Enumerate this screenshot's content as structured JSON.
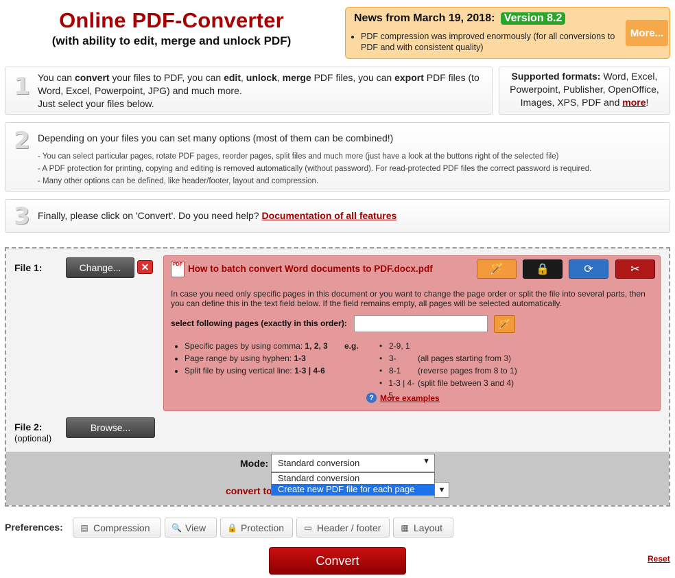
{
  "header": {
    "title": "Online PDF-Converter",
    "subtitle": "(with ability to edit, merge and unlock PDF)"
  },
  "news": {
    "heading": "News from March 19, 2018:",
    "version": "Version 8.2",
    "item": "PDF compression was improved enormously (for all conversions to PDF and with consistent quality)",
    "more_label": "More..."
  },
  "step1": {
    "number": "1",
    "t1": "You can ",
    "b1": "convert",
    "t2": " your files to PDF, you can ",
    "b2": "edit",
    "t3": ", ",
    "b3": "unlock",
    "t4": ", ",
    "b4": "merge",
    "t5": " PDF files, you can ",
    "b5": "export",
    "t6": " PDF files (to Word, Excel, Powerpoint, JPG) and much more.",
    "line2": "Just select your files below."
  },
  "formats": {
    "label": "Supported formats:",
    "text": " Word, Excel, Powerpoint, Publisher, OpenOffice, Images, XPS, PDF and ",
    "more_link": "more",
    "suffix": "!"
  },
  "step2": {
    "number": "2",
    "heading": "Depending on your files you can set many options (most of them can be combined!)",
    "bullets": [
      "- You can select particular pages, rotate PDF pages, reorder pages, split files and much more (just have a look at the buttons right of the selected file)",
      "- A PDF protection for printing, copying and editing is removed automatically (without password). For read-protected PDF files the correct password is required.",
      "- Many other options can be defined, like header/footer, layout and compression."
    ]
  },
  "step3": {
    "number": "3",
    "text": "Finally, please click on 'Convert'. Do you need help? ",
    "link": "Documentation of all features"
  },
  "file1": {
    "label": "File 1:",
    "change_label": "Change...",
    "remove_label": "✕",
    "filename": "How to batch convert Word documents to PDF.docx.pdf",
    "pdf_icon_text": "PDF",
    "description": "In case you need only specific pages in this document or you want to change the page order or split the file into several parts, then you can define this in the text field below. If the field remains empty, all pages will be selected automatically.",
    "pages_label": "select following pages (exactly in this order):",
    "pages_value": "",
    "hints": [
      {
        "text": "Specific pages by using comma: ",
        "bold": "1, 2, 3"
      },
      {
        "text": "Page range by using hyphen: ",
        "bold": "1-3"
      },
      {
        "text": "Split file by using vertical line: ",
        "bold": "1-3 | 4-6"
      }
    ],
    "eg_label": "e.g.",
    "examples": [
      {
        "value": "2-9, 1",
        "note": ""
      },
      {
        "value": "3-",
        "note": "(all pages starting from 3)"
      },
      {
        "value": "8-1",
        "note": "(reverse pages from 8 to 1)"
      },
      {
        "value": "1-3 | 4-5",
        "note": "(split file between 3 and 4)"
      }
    ],
    "more_examples": "More examples"
  },
  "file2": {
    "label": "File 2:",
    "optional": "(optional)",
    "browse_label": "Browse..."
  },
  "mode": {
    "label": "Mode:",
    "selected": "Standard conversion",
    "options": [
      "Standard conversion",
      "Create new PDF file for each page"
    ],
    "convert_to_label": "convert to"
  },
  "preferences": {
    "label": "Preferences:",
    "buttons": [
      "Compression",
      "View",
      "Protection",
      "Header / footer",
      "Layout"
    ]
  },
  "actions": {
    "convert_label": "Convert",
    "reset_label": "Reset"
  },
  "icons": {
    "wand": "magic-wand-icon",
    "lock": "lock-icon",
    "rotate": "rotate-icon",
    "scissors": "scissors-icon"
  },
  "colors": {
    "brand_red": "#a80000",
    "panel_bg": "#e49a9a",
    "news_bg": "#fcd9a1",
    "version_green": "#2aa52a",
    "dropdown_highlight": "#1e73e8"
  }
}
